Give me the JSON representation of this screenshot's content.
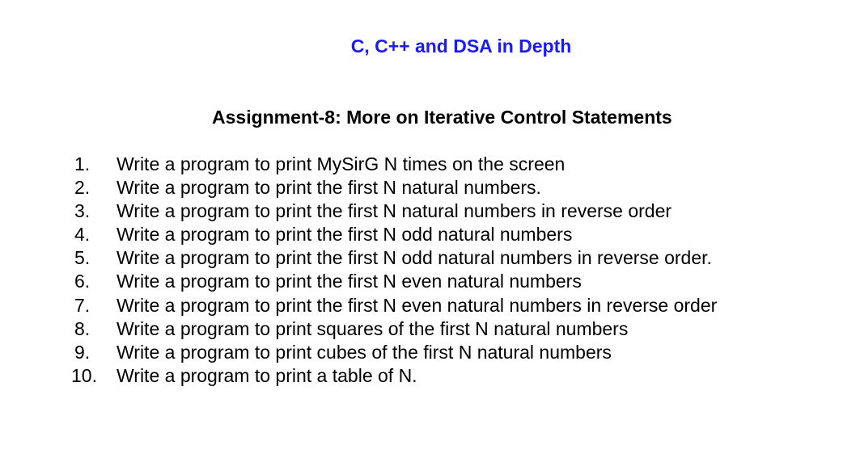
{
  "document": {
    "course_title": "C, C++ and DSA in Depth",
    "assignment_title": "Assignment-8: More on Iterative Control Statements",
    "tasks": [
      {
        "number": "1.",
        "text": "Write a program to print MySirG N times on the screen"
      },
      {
        "number": "2.",
        "text": "Write a program to print the first N natural numbers."
      },
      {
        "number": "3.",
        "text": "Write a program to print the first N natural numbers in reverse order"
      },
      {
        "number": "4.",
        "text": "Write a program to print the first N odd natural numbers"
      },
      {
        "number": "5.",
        "text": "Write a program to print the first N odd natural numbers in reverse order."
      },
      {
        "number": "6.",
        "text": "Write a program to print the first N even natural numbers"
      },
      {
        "number": "7.",
        "text": "Write a program to print the first N even natural numbers in reverse order"
      },
      {
        "number": "8.",
        "text": "Write a program to print squares of the first N natural numbers"
      },
      {
        "number": "9.",
        "text": "Write a program to print cubes of the first N natural numbers"
      },
      {
        "number": "10.",
        "text": "Write a program to print a table of N."
      }
    ]
  },
  "colors": {
    "course_title": "#1a1aff",
    "body_text": "#000000",
    "background": "#ffffff"
  }
}
